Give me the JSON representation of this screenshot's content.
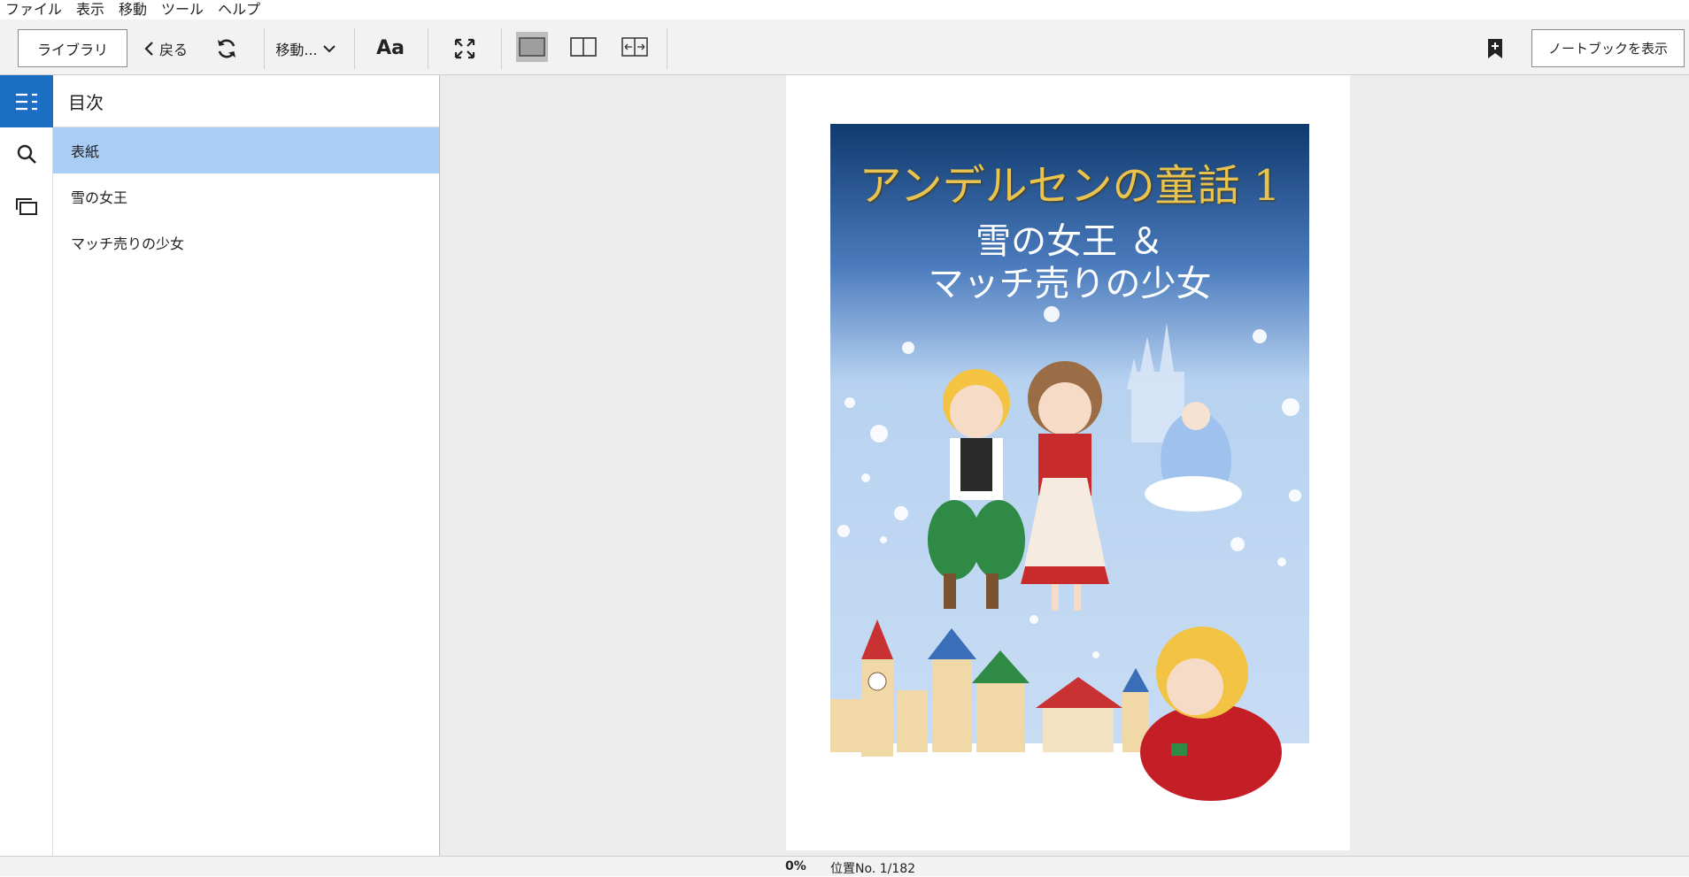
{
  "menubar": {
    "items": [
      "ファイル",
      "表示",
      "移動",
      "ツール",
      "ヘルプ"
    ]
  },
  "toolbar": {
    "library_label": "ライブラリ",
    "back_label": "戻る",
    "goto_label": "移動...",
    "font_label": "Aa",
    "notebook_label": "ノートブックを表示",
    "accent_color": "#1b6ec2"
  },
  "toc": {
    "title": "目次",
    "items": [
      {
        "label": "表紙",
        "selected": true
      },
      {
        "label": "雪の女王",
        "selected": false
      },
      {
        "label": "マッチ売りの少女",
        "selected": false
      }
    ],
    "selected_color": "#a9cdf5"
  },
  "cover": {
    "title_line1": "アンデルセンの童話 1",
    "title_line2": "雪の女王 ＆",
    "title_line3": "マッチ売りの少女"
  },
  "status": {
    "progress": "0%",
    "location": "位置No. 1/182"
  }
}
